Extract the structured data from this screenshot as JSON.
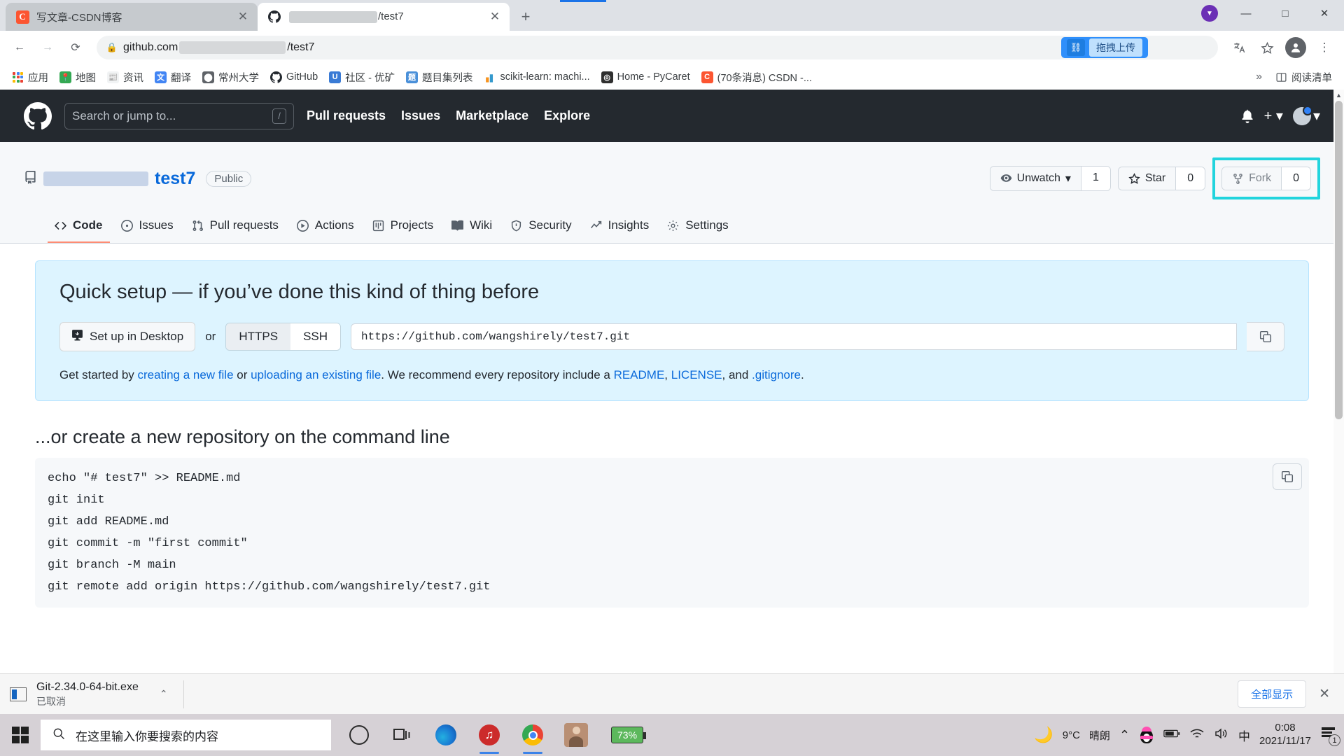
{
  "browser": {
    "tabs": [
      {
        "title": "写文章-CSDN博客",
        "favicon": "csdn-icon",
        "active": false,
        "redacted": false
      },
      {
        "title": "/test7",
        "favicon": "github-icon",
        "active": true,
        "redacted": true
      }
    ],
    "new_tab_label": "+",
    "window_controls": {
      "minimize": "—",
      "maximize": "□",
      "close": "✕"
    },
    "nav": {
      "back": "←",
      "forward": "→",
      "reload": "⟳"
    },
    "omnibox": {
      "url_prefix": "github.com",
      "url_suffix": "/test7",
      "lock_icon": "lock-icon"
    },
    "extension_button": {
      "label": "拖拽上传",
      "icon": "upload-extension-icon"
    },
    "toolbar_icons": [
      "translate-icon",
      "bookmark-star-icon",
      "profile-icon",
      "menu-icon"
    ],
    "bookmarks": [
      {
        "label": "应用",
        "icon": "apps-grid-icon"
      },
      {
        "label": "地图",
        "icon": "google-maps-icon"
      },
      {
        "label": "资讯",
        "icon": "google-news-icon"
      },
      {
        "label": "翻译",
        "icon": "google-translate-icon"
      },
      {
        "label": "常州大学",
        "icon": "university-icon"
      },
      {
        "label": "GitHub",
        "icon": "github-icon"
      },
      {
        "label": "社区 - 优矿",
        "icon": "uqer-icon"
      },
      {
        "label": "题目集列表",
        "icon": "problem-list-icon"
      },
      {
        "label": "scikit-learn: machi...",
        "icon": "scikit-learn-icon"
      },
      {
        "label": "Home - PyCaret",
        "icon": "pycaret-icon"
      },
      {
        "label": "(70条消息) CSDN -...",
        "icon": "csdn-icon"
      }
    ],
    "bookmarks_overflow": "»",
    "reading_list": {
      "label": "阅读清单",
      "icon": "reading-list-icon"
    }
  },
  "github": {
    "header": {
      "logo": "github-mark-icon",
      "search_placeholder": "Search or jump to...",
      "search_shortcut": "/",
      "nav": [
        "Pull requests",
        "Issues",
        "Marketplace",
        "Explore"
      ],
      "bell_icon": "bell-icon",
      "plus_icon": "plus-icon",
      "avatar": "user-avatar"
    },
    "repo": {
      "owner": "",
      "name": "test7",
      "visibility": "Public",
      "repo_icon": "repo-icon",
      "actions": {
        "watch": {
          "label": "Unwatch",
          "count": "1",
          "icon": "eye-icon"
        },
        "star": {
          "label": "Star",
          "count": "0",
          "icon": "star-icon"
        },
        "fork": {
          "label": "Fork",
          "count": "0",
          "icon": "fork-icon",
          "highlighted": true
        }
      },
      "highlight_color": "#21d4dd",
      "tabs": [
        {
          "label": "Code",
          "icon": "code-icon",
          "active": true
        },
        {
          "label": "Issues",
          "icon": "issue-opened-icon",
          "active": false
        },
        {
          "label": "Pull requests",
          "icon": "git-pull-request-icon",
          "active": false
        },
        {
          "label": "Actions",
          "icon": "play-icon",
          "active": false
        },
        {
          "label": "Projects",
          "icon": "project-board-icon",
          "active": false
        },
        {
          "label": "Wiki",
          "icon": "book-icon",
          "active": false
        },
        {
          "label": "Security",
          "icon": "shield-icon",
          "active": false
        },
        {
          "label": "Insights",
          "icon": "graph-icon",
          "active": false
        },
        {
          "label": "Settings",
          "icon": "gear-icon",
          "active": false
        }
      ]
    },
    "quick_setup": {
      "title": "Quick setup — if you’ve done this kind of thing before",
      "desktop_button": "Set up in Desktop",
      "desktop_icon": "desktop-download-icon",
      "or": "or",
      "protocol_https": "HTTPS",
      "protocol_ssh": "SSH",
      "selected_protocol": "HTTPS",
      "clone_url": "https://github.com/wangshirely/test7.git",
      "copy_icon": "copy-icon",
      "footer": {
        "prefix": "Get started by ",
        "link1": "creating a new file",
        "mid1": " or ",
        "link2": "uploading an existing file",
        "mid2": ". We recommend every repository include a ",
        "link3": "README",
        "comma1": ", ",
        "link4": "LICENSE",
        "mid3": ", and ",
        "link5": ".gitignore",
        "period": "."
      }
    },
    "command_line": {
      "title": "...or create a new repository on the command line",
      "lines": [
        "echo \"# test7\" >> README.md",
        "git init",
        "git add README.md",
        "git commit -m \"first commit\"",
        "git branch -M main",
        "git remote add origin https://github.com/wangshirely/test7.git"
      ],
      "copy_icon": "copy-icon"
    }
  },
  "downloads_bar": {
    "file_name": "Git-2.34.0-64-bit.exe",
    "status": "已取消",
    "file_icon": "exe-file-icon",
    "caret": "⌃",
    "show_all": "全部显示",
    "close": "✕"
  },
  "taskbar": {
    "start_icon": "windows-start-icon",
    "search_placeholder": "在这里输入你要搜索的内容",
    "search_icon": "search-icon",
    "apps": [
      {
        "name": "cortana-icon",
        "running": false
      },
      {
        "name": "task-view-icon",
        "running": false
      },
      {
        "name": "microsoft-edge-icon",
        "running": false
      },
      {
        "name": "netease-music-icon",
        "running": true
      },
      {
        "name": "google-chrome-icon",
        "running": true
      },
      {
        "name": "photos-app-icon",
        "running": false
      }
    ],
    "battery_percent": "73%",
    "tray": {
      "weather_icon": "moon-icon",
      "temperature": "9°C",
      "weather_text": "晴朗",
      "chevron": "⌃",
      "qq_icon": "qq-penguin-icon",
      "battery_icon": "battery-icon",
      "wifi_icon": "wifi-icon",
      "volume_icon": "volume-icon",
      "ime": "中",
      "time": "0:08",
      "date": "2021/11/17",
      "notification_icon": "action-center-icon",
      "notification_count": "1"
    }
  }
}
